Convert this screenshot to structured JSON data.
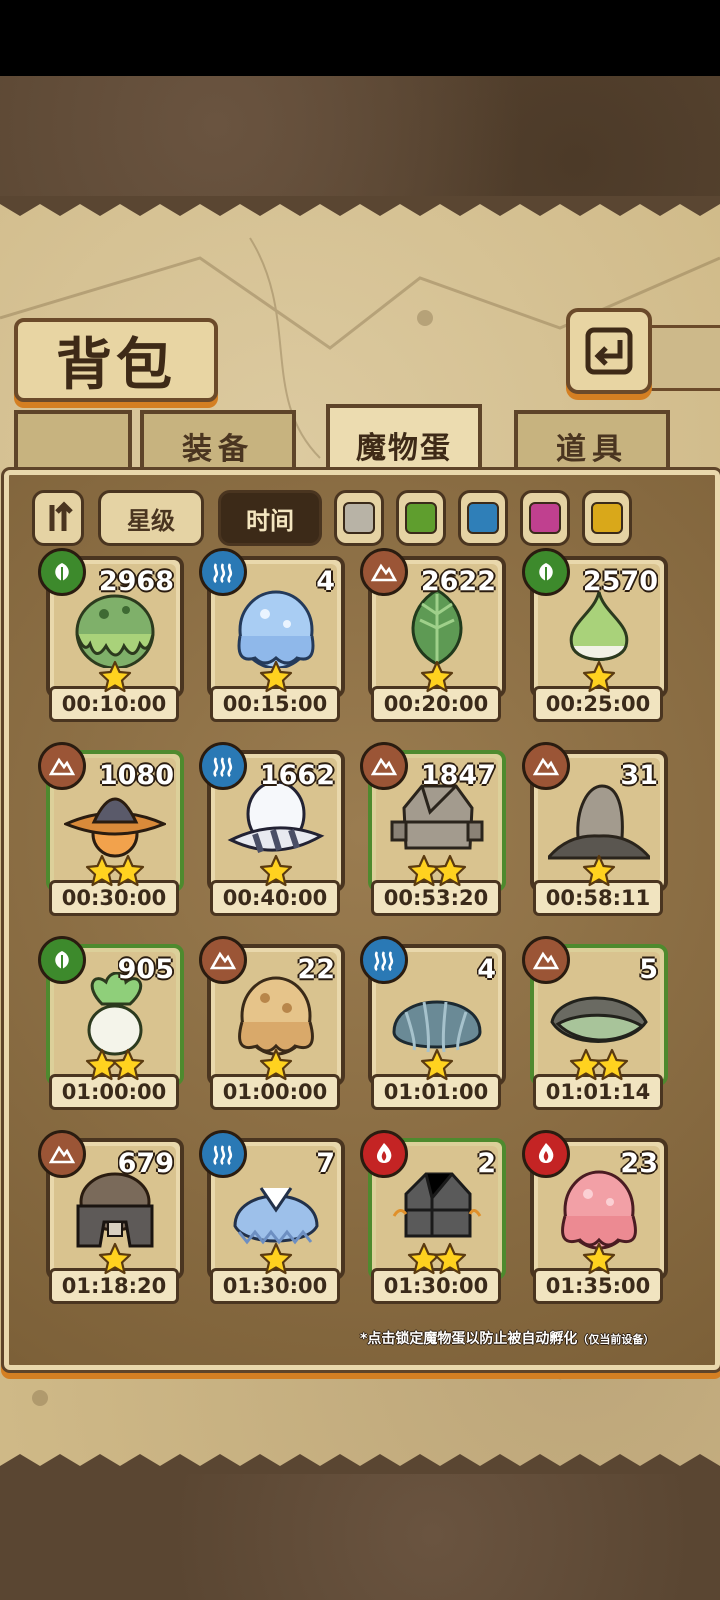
{
  "header": {
    "title": "背包"
  },
  "tabs": [
    {
      "label": "装备",
      "active": false
    },
    {
      "label": "魔物蛋",
      "active": true
    },
    {
      "label": "道具",
      "active": false
    }
  ],
  "filters": {
    "sort_icon": "sort-toggle-icon",
    "star_label": "星级",
    "time_label": "时间",
    "time_active": true,
    "swatches": [
      "#b8b3a6",
      "#5f9e2e",
      "#2f7fb8",
      "#c0408f",
      "#d9a81a"
    ]
  },
  "elements": {
    "earth": "#9b5536",
    "water": "#2a79b5",
    "grass": "#3d8a2c",
    "fire": "#c42424"
  },
  "eggs": [
    {
      "element": "grass",
      "count": "2968",
      "stars": 1,
      "time": "00:10:00",
      "egg": "green-slime-egg",
      "rare": false
    },
    {
      "element": "water",
      "count": "4",
      "stars": 1,
      "time": "00:15:00",
      "egg": "blue-slime-egg",
      "rare": false
    },
    {
      "element": "earth",
      "count": "2622",
      "stars": 1,
      "time": "00:20:00",
      "egg": "leaf-egg",
      "rare": false
    },
    {
      "element": "grass",
      "count": "2570",
      "stars": 1,
      "time": "00:25:00",
      "egg": "onion-egg",
      "rare": false
    },
    {
      "element": "earth",
      "count": "1080",
      "stars": 2,
      "time": "00:30:00",
      "egg": "witch-hat-egg",
      "rare": true
    },
    {
      "element": "water",
      "count": "1662",
      "stars": 1,
      "time": "00:40:00",
      "egg": "striped-egg",
      "rare": false
    },
    {
      "element": "earth",
      "count": "1847",
      "stars": 2,
      "time": "00:53:20",
      "egg": "rock-golem-egg",
      "rare": true
    },
    {
      "element": "earth",
      "count": "31",
      "stars": 1,
      "time": "00:58:11",
      "egg": "stone-pile-egg",
      "rare": false
    },
    {
      "element": "grass",
      "count": "905",
      "stars": 2,
      "time": "01:00:00",
      "egg": "turnip-egg",
      "rare": true
    },
    {
      "element": "earth",
      "count": "22",
      "stars": 1,
      "time": "01:00:00",
      "egg": "tan-slime-egg",
      "rare": false
    },
    {
      "element": "water",
      "count": "4",
      "stars": 1,
      "time": "01:01:00",
      "egg": "shell-egg",
      "rare": false
    },
    {
      "element": "earth",
      "count": "5",
      "stars": 2,
      "time": "01:01:14",
      "egg": "leafy-shell-egg",
      "rare": true
    },
    {
      "element": "earth",
      "count": "679",
      "stars": 1,
      "time": "01:18:20",
      "egg": "armored-egg",
      "rare": false
    },
    {
      "element": "water",
      "count": "7",
      "stars": 1,
      "time": "01:30:00",
      "egg": "blue-cloak-egg",
      "rare": false
    },
    {
      "element": "fire",
      "count": "2",
      "stars": 2,
      "time": "01:30:00",
      "egg": "dark-rock-egg",
      "rare": true
    },
    {
      "element": "fire",
      "count": "23",
      "stars": 1,
      "time": "01:35:00",
      "egg": "pink-slime-egg",
      "rare": false
    }
  ],
  "hint": {
    "main": "*点击锁定魔物蛋以防止被自动孵化",
    "sub": "（仅当前设备）"
  }
}
